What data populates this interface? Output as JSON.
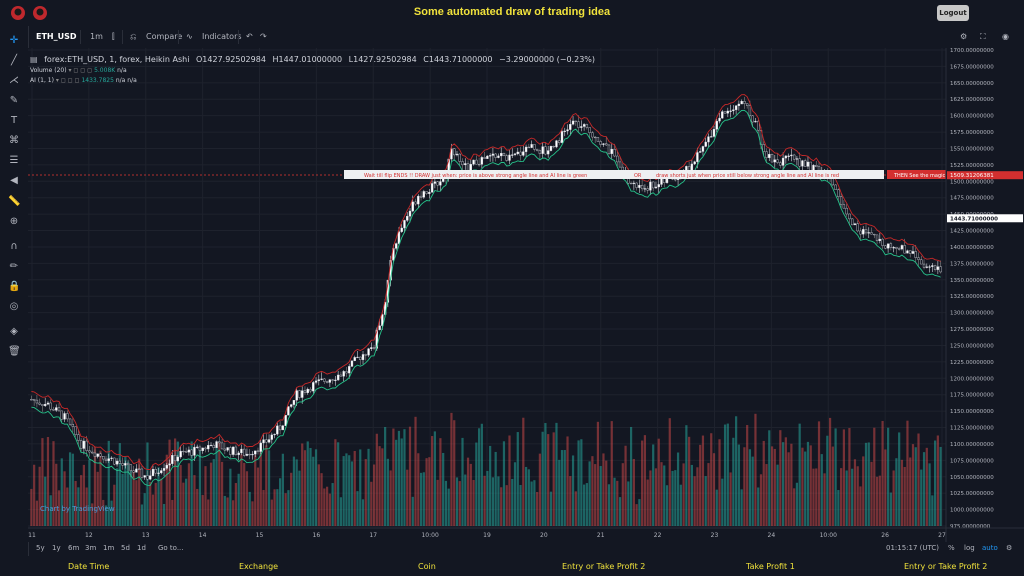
{
  "header": {
    "title": "Some automated draw of trading idea",
    "logout_label": "Logout"
  },
  "toolbar": {
    "symbol": "ETH_USD",
    "interval": "1m",
    "compare_label": "Compare",
    "indicators_label": "Indicators"
  },
  "legend": {
    "symbol_line": "forex:ETH_USD, 1, forex, Heikin Ashi",
    "open": "O1427.92502984",
    "high": "H1447.01000000",
    "low": "L1427.92502984",
    "close": "C1443.71000000",
    "change": "−3.29000000 (−0.23%)",
    "volume_label": "Volume (20)",
    "volume_value": "5.008K",
    "volume_na": "n/a",
    "ai_label": "AI (1, 1)",
    "ai_value": "1433.7825",
    "ai_na1": "n/a",
    "ai_na2": "n/a"
  },
  "annotations": {
    "left_text": "Wait till flip ENDS !!   DRAW just when:  price is above strong angle line and AI line is green",
    "or_text": "OR",
    "right_text": "draw shorts just when price still below strong angle line and AI line is red",
    "magic": "THEN See the magic!!",
    "level": "1509.31206381"
  },
  "chart_data": {
    "type": "candlestick",
    "x_ticks": [
      "11",
      "12",
      "13",
      "14",
      "15",
      "16",
      "17",
      "10:00",
      "19",
      "20",
      "21",
      "22",
      "23",
      "24",
      "10:00",
      "26",
      "27"
    ],
    "y_ticks": [
      "1700.00000000",
      "1675.00000000",
      "1650.00000000",
      "1625.00000000",
      "1600.00000000",
      "1575.00000000",
      "1550.00000000",
      "1525.00000000",
      "1500.00000000",
      "1475.00000000",
      "1450.00000000",
      "1425.00000000",
      "1400.00000000",
      "1375.00000000",
      "1350.00000000",
      "1325.00000000",
      "1300.00000000",
      "1275.00000000",
      "1250.00000000",
      "1225.00000000",
      "1200.00000000",
      "1175.00000000",
      "1150.00000000",
      "1125.00000000",
      "1100.00000000",
      "1075.00000000",
      "1050.00000000",
      "1025.00000000",
      "1000.00000000",
      "975.00000000"
    ],
    "ylim": [
      975,
      1700
    ],
    "current_price": "1443.71000000",
    "annotation_level": 1509.31206381,
    "price_path": [
      [
        0,
        1168
      ],
      [
        6,
        1160
      ],
      [
        12,
        1140
      ],
      [
        18,
        1100
      ],
      [
        24,
        1085
      ],
      [
        30,
        1075
      ],
      [
        36,
        1060
      ],
      [
        42,
        1050
      ],
      [
        48,
        1068
      ],
      [
        54,
        1085
      ],
      [
        60,
        1090
      ],
      [
        66,
        1100
      ],
      [
        72,
        1090
      ],
      [
        78,
        1085
      ],
      [
        84,
        1100
      ],
      [
        90,
        1125
      ],
      [
        96,
        1175
      ],
      [
        102,
        1190
      ],
      [
        108,
        1200
      ],
      [
        114,
        1210
      ],
      [
        118,
        1230
      ],
      [
        124,
        1250
      ],
      [
        128,
        1320
      ],
      [
        131,
        1400
      ],
      [
        135,
        1440
      ],
      [
        140,
        1480
      ],
      [
        145,
        1490
      ],
      [
        150,
        1510
      ],
      [
        152,
        1555
      ],
      [
        156,
        1520
      ],
      [
        162,
        1530
      ],
      [
        168,
        1540
      ],
      [
        174,
        1535
      ],
      [
        180,
        1555
      ],
      [
        186,
        1545
      ],
      [
        192,
        1570
      ],
      [
        196,
        1590
      ],
      [
        200,
        1580
      ],
      [
        204,
        1570
      ],
      [
        208,
        1550
      ],
      [
        212,
        1535
      ],
      [
        216,
        1500
      ],
      [
        220,
        1490
      ],
      [
        226,
        1495
      ],
      [
        232,
        1505
      ],
      [
        238,
        1520
      ],
      [
        243,
        1550
      ],
      [
        249,
        1600
      ],
      [
        254,
        1615
      ],
      [
        258,
        1620
      ],
      [
        262,
        1585
      ],
      [
        266,
        1540
      ],
      [
        270,
        1530
      ],
      [
        276,
        1535
      ],
      [
        282,
        1520
      ],
      [
        288,
        1510
      ],
      [
        292,
        1480
      ],
      [
        296,
        1440
      ],
      [
        300,
        1425
      ],
      [
        306,
        1410
      ],
      [
        312,
        1400
      ],
      [
        318,
        1395
      ],
      [
        324,
        1370
      ],
      [
        330,
        1360
      ],
      [
        335,
        1440
      ]
    ],
    "volume_bars": "~330 bars between 0 and ~10k; mixed red/green"
  },
  "bottom": {
    "ranges": [
      "5y",
      "1y",
      "6m",
      "3m",
      "1m",
      "5d",
      "1d"
    ],
    "goto": "Go to...",
    "clock": "01:15:17 (UTC)",
    "percent": "%",
    "log": "log",
    "auto": "auto"
  },
  "watermark": "Chart by TradingView",
  "footer": [
    "Date Time",
    "Exchange",
    "Coin",
    "Entry or Take Profit 2",
    "Take Profit 1",
    "Entry or Take Profit 2"
  ]
}
